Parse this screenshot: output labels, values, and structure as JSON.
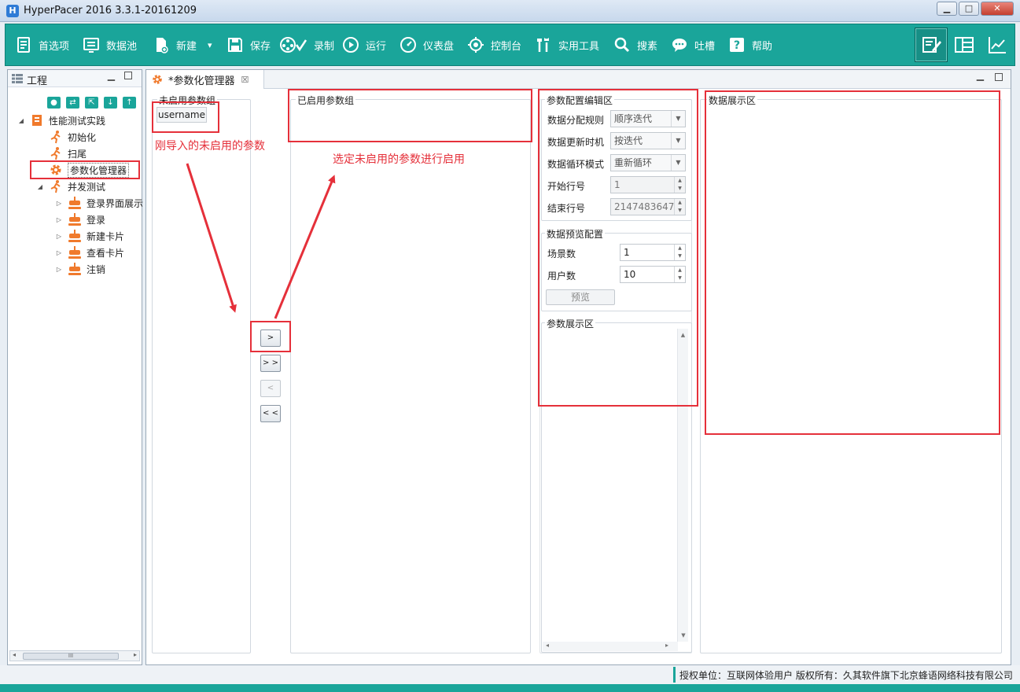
{
  "window": {
    "title": "HyperPacer  2016 3.3.1-20161209",
    "minimize": "▁",
    "maximize": "□",
    "close": "✕"
  },
  "toolbar": {
    "items": [
      {
        "label": "首选项",
        "icon": "preferences-icon"
      },
      {
        "label": "数据池",
        "icon": "data-pool-icon"
      },
      {
        "label": "新建",
        "icon": "new-file-icon"
      },
      {
        "label": "保存",
        "icon": "save-icon"
      },
      {
        "label": "录制",
        "icon": "record-icon"
      },
      {
        "label": "运行",
        "icon": "run-icon"
      },
      {
        "label": "仪表盘",
        "icon": "dashboard-icon"
      },
      {
        "label": "控制台",
        "icon": "console-icon"
      },
      {
        "label": "实用工具",
        "icon": "tools-icon"
      },
      {
        "label": "搜素",
        "icon": "search-icon"
      },
      {
        "label": "吐槽",
        "icon": "feedback-icon"
      },
      {
        "label": "帮助",
        "icon": "help-icon"
      }
    ],
    "new_dropdown": "▾"
  },
  "project": {
    "title": "工程",
    "min": "▁",
    "tree": [
      {
        "label": "性能测试实践",
        "twist": "◢",
        "icon": "project-book-icon"
      },
      {
        "label": "初始化",
        "twist": "",
        "icon": "runner-icon"
      },
      {
        "label": "扫尾",
        "twist": "",
        "icon": "runner-icon"
      },
      {
        "label": "参数化管理器",
        "twist": "",
        "icon": "gear-icon"
      },
      {
        "label": "并发测试",
        "twist": "◢",
        "icon": "runner-icon"
      },
      {
        "label": "登录界面展示",
        "twist": "▷",
        "icon": "transaction-icon"
      },
      {
        "label": "登录",
        "twist": "▷",
        "icon": "transaction-icon"
      },
      {
        "label": "新建卡片",
        "twist": "▷",
        "icon": "transaction-icon"
      },
      {
        "label": "查看卡片",
        "twist": "▷",
        "icon": "transaction-icon"
      },
      {
        "label": "注销",
        "twist": "▷",
        "icon": "transaction-icon"
      }
    ],
    "scroll_thumb": "III",
    "scroll_left": "◂",
    "scroll_right": "▸"
  },
  "editor": {
    "tab_label": "*参数化管理器",
    "tab_close": "☒",
    "min": "▁",
    "disabled_group": {
      "title": "未启用参数组",
      "items": [
        "username"
      ]
    },
    "enabled_group": {
      "title": "已启用参数组"
    },
    "buttons": {
      "move_one": ">",
      "move_all": "> >",
      "remove_one": "<",
      "remove_all": "< <"
    },
    "config": {
      "title": "参数配置编辑区",
      "distribution_label": "数据分配规则",
      "distribution_value": "顺序迭代",
      "update_label": "数据更新时机",
      "update_value": "按迭代",
      "loop_label": "数据循环模式",
      "loop_value": "重新循环",
      "start_label": "开始行号",
      "start_value": "1",
      "end_label": "结束行号",
      "end_value": "2147483647"
    },
    "preview": {
      "title": "数据预览配置",
      "scenes_label": "场景数",
      "scenes_value": "1",
      "users_label": "用户数",
      "users_value": "10",
      "button": "预览"
    },
    "param_display_title": "参数展示区",
    "data_display_title": "数据展示区"
  },
  "annotations": {
    "newly_imported": "刚导入的未启用的参数",
    "select_enable": "选定未启用的参数进行启用"
  },
  "status": {
    "text": "授权单位：互联网体验用户 版权所有：久其软件旗下北京蜂语网络科技有限公司"
  },
  "colors": {
    "accent": "#1aa59a",
    "annotation_red": "#e5303a",
    "tree_icon_orange": "#f07a2c"
  }
}
